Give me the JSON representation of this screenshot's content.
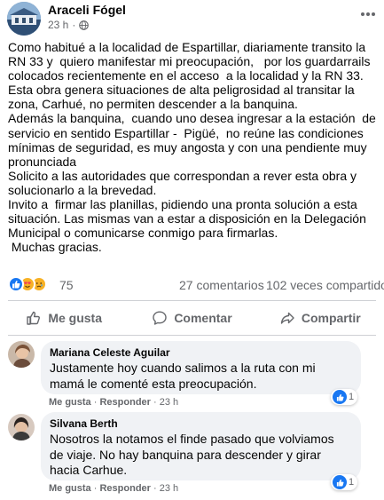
{
  "post": {
    "author": "Araceli Fógel",
    "time": "23 h",
    "paragraphs": [
      "Como habitué a la localidad de Espartillar, diariamente transito la RN 33 y  quiero manifestar mi preocupación,   por los guardarrails colocados recientemente en el acceso  a la localidad y la RN 33.",
      "Esta obra genera situaciones de alta peligrosidad al transitar la zona, Carhué, no permiten descender a la banquina.",
      "Además la banquina,  cuando uno desea ingresar a la estación  de servicio en sentido Espartillar -  Pigüé,  no reúne las condiciones mínimas de seguridad, es muy angosta y con una pendiente muy pronunciada",
      "Solicito a las autoridades que correspondan a rever esta obra y solucionarlo a la brevedad.",
      "Invito a  firmar las planillas, pidiendo una pronta solución a esta situación. Las mismas van a estar a disposición en la Delegación Municipal o comunicarse conmigo para firmarlas.",
      " Muchas gracias."
    ]
  },
  "stats": {
    "reactions": "75",
    "comments": "27 comentarios",
    "shares": "102 veces compartido"
  },
  "actions": {
    "like": "Me gusta",
    "comment": "Comentar",
    "share": "Compartir"
  },
  "comments": [
    {
      "author": "Mariana Celeste Aguilar",
      "text": "Justamente hoy cuando salimos a la ruta con mi mamá le comenté esta preocupación.",
      "like_label": "Me gusta",
      "reply_label": "Responder",
      "time": "23 h",
      "likes": "1"
    },
    {
      "author": "Silvana Berth",
      "text": "Nosotros la notamos el finde pasado que volviamos de viaje. No hay banquina para descender y girar hacia Carhue.",
      "like_label": "Me gusta",
      "reply_label": "Responder",
      "time": "23 h",
      "likes": "1"
    }
  ],
  "icons": {
    "audience": "globe-icon",
    "more": "more-horizontal-icon",
    "like_action": "thumbs-up-outline-icon",
    "comment_action": "speech-bubble-icon",
    "share_action": "share-arrow-icon",
    "reactions": [
      "like-reaction-icon",
      "love-reaction-icon",
      "sad-reaction-icon"
    ]
  },
  "colors": {
    "text": "#050505",
    "secondary_text": "#65676b",
    "like_blue": "#1877f2",
    "love_red": "#f33e58",
    "sad_yellow": "#f7b125",
    "bubble_bg": "#f0f2f5",
    "divider": "#ced0d4"
  }
}
